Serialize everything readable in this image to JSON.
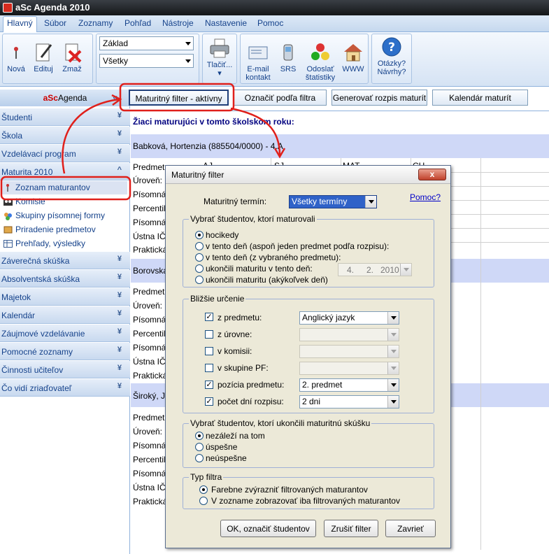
{
  "window": {
    "title": "aSc Agenda 2010"
  },
  "menu": [
    "Hlavný",
    "Súbor",
    "Zoznamy",
    "Pohľad",
    "Nástroje",
    "Nastavenie",
    "Pomoc"
  ],
  "ribbon": {
    "nova": "Nová",
    "edituj": "Edituj",
    "zmaz": "Zmaž",
    "combo1": "Základ",
    "combo2": "Všetky",
    "tlacit": "Tlačiť...",
    "email": "E-mail",
    "kontakt": "kontakt",
    "srs": "SRS",
    "odoslat": "Odoslať",
    "statistiky": "štatistiky",
    "www": "WWW",
    "otazky": "Otázky?",
    "navrhy": "Návrhy?"
  },
  "sidebar": {
    "header_brand": "aSc",
    "header_rest": "Agenda",
    "sections_top": [
      "Študenti",
      "Škola",
      "Vzdelávací program",
      "Maturita 2010"
    ],
    "items": [
      "Zoznam maturantov",
      "Komisie",
      "Skupiny písomnej formy",
      "Priradenie predmetov",
      "Prehľady, výsledky"
    ],
    "sections_bottom": [
      "Záverečná skúška",
      "Absolventská skúška",
      "Majetok",
      "Kalendár",
      "Záujmové vzdelávanie",
      "Pomocné zoznamy",
      "Činnosti učiteľov",
      "Čo vidí zriaďovateľ"
    ]
  },
  "toolbar": {
    "btn1": "Maturitný filter - aktívny",
    "btn2": "Označiť podľa filtra",
    "btn3": "Generovať rozpis maturít",
    "btn4": "Kalendár maturít"
  },
  "main": {
    "heading": "Žiaci maturujúci v tomto školskom roku:",
    "student1": "Babková, Hortenzia (885504/0000) - 4.A",
    "student2": "Borovská",
    "student3": "Široký, J",
    "col_aj": "AJ",
    "col_sj": "SJ",
    "col_mat": "MAT",
    "col_ch": "CH",
    "row_labels": [
      "Predmet:",
      "Úroveň:",
      "Písomná",
      "Percentil:",
      "Písomná",
      "Ústna IČ:",
      "Praktická"
    ]
  },
  "dialog": {
    "title": "Maturitný filter",
    "close": "x",
    "term_label": "Maturitný termín:",
    "term_value": "Všetky termíny",
    "help": "Pomoc?",
    "g1_title": "Vybrať študentov, ktorí maturovali",
    "g1_opts": [
      "hocikedy",
      "v tento deň (aspoň jeden predmet podľa rozpisu):",
      "v tento deň (z vybraného predmetu):",
      "ukončili maturitu v tento deň:",
      "ukončili maturitu (akýkoľvek deň)"
    ],
    "date": {
      "d": "4.",
      "m": "2.",
      "y": "2010"
    },
    "g2_title": "Bližšie určenie",
    "g2_rows": [
      {
        "label": "z predmetu:",
        "value": "Anglický jazyk",
        "checked": true
      },
      {
        "label": "z úrovne:",
        "value": "",
        "checked": false
      },
      {
        "label": "v komisii:",
        "value": "",
        "checked": false
      },
      {
        "label": "v skupine PF:",
        "value": "",
        "checked": false
      },
      {
        "label": "pozícia predmetu:",
        "value": "2. predmet",
        "checked": true
      },
      {
        "label": "počet dní rozpisu:",
        "value": "2 dni",
        "checked": true
      }
    ],
    "g3_title": "Vybrať študentov, ktorí ukončili maturitnú skúšku",
    "g3_opts": [
      "nezáleží na tom",
      "úspešne",
      "neúspešne"
    ],
    "g4_title": "Typ filtra",
    "g4_opts": [
      "Farebne zvýrazniť filtrovaných maturantov",
      "V zozname zobrazovať iba filtrovaných maturantov"
    ],
    "btn_ok": "OK, označiť študentov",
    "btn_clear": "Zrušiť filter",
    "btn_close": "Zavrieť"
  },
  "colors": {
    "annotation": "#e0201b",
    "accent": "#15428b"
  }
}
